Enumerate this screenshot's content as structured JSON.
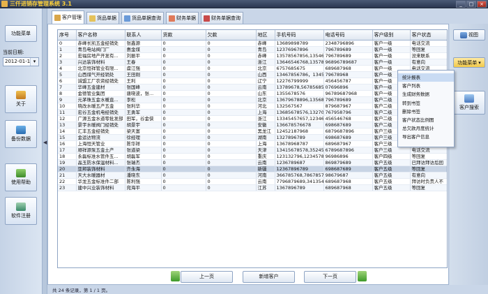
{
  "window": {
    "title": "三仟进销存管理系统 3.1",
    "buttons": [
      "_",
      "□",
      "×"
    ]
  },
  "left_panel": {
    "func_menu": "功能菜单",
    "date_label": "当前日期:",
    "date_value": "2012-01-12",
    "about": "关于",
    "backup": "备份数据",
    "help": "使用帮助",
    "register": "软件注册"
  },
  "tabs": [
    {
      "label": "客户管理",
      "color": "#d9a64a"
    },
    {
      "label": "货品单据",
      "color": "#e5c25a"
    },
    {
      "label": "货品单据查询",
      "color": "#6a9ad8"
    },
    {
      "label": "财务单据",
      "color": "#e07a5a"
    },
    {
      "label": "财务单据查询",
      "color": "#c84a4a"
    }
  ],
  "table": {
    "columns": [
      "序号",
      "客户名称",
      "联系人",
      "货款",
      "欠款",
      "地区",
      "手机号码",
      "电话号码",
      "客户级别",
      "客户状态"
    ],
    "rows": [
      [
        "0",
        "赤峰长凯五金经销处",
        "张鑫源",
        "0",
        "0",
        "赤峰",
        "13689898789",
        "2348796896",
        "客户一级",
        "电话交流"
      ],
      [
        "1",
        "青岛电站阀门厂",
        "惠金煤",
        "0",
        "0",
        "青岛",
        "12376967896",
        "796789689",
        "客户一级",
        "等回复"
      ],
      [
        "2",
        "宏福房地产开发有...",
        "刘振平",
        "0",
        "0",
        "赤峰",
        "13578567856,13546456",
        "796789689",
        "客户一级",
        "没来联系"
      ],
      [
        "3",
        "兴达装饰材料",
        "王春",
        "0",
        "0",
        "浙江",
        "13646546768,135789...",
        "96896789687",
        "客户一级",
        "有意向"
      ],
      [
        "4",
        "北京恒祥管业有限...",
        "虞江强",
        "0",
        "0",
        "北京",
        "6757685675",
        "689687968",
        "客户一级",
        "电话交流"
      ],
      [
        "5",
        "山西煤气开经销处",
        "王田刚",
        "0",
        "0",
        "山西",
        "13467856786，1345...",
        "79678968",
        "客户一级",
        "电话交流"
      ],
      [
        "6",
        "诚盟工厂农资经销处",
        "王利",
        "0",
        "0",
        "辽宁",
        "12276799999",
        "456456787",
        "客户一级",
        "电话交流"
      ],
      [
        "7",
        "华峰五金建材",
        "张国峰",
        "0",
        "0",
        "云南",
        "13789678,56785685",
        "07696896",
        "客户一级",
        "有意向"
      ],
      [
        "8",
        "金德管业集团",
        "唐晓波，张...",
        "0",
        "0",
        "山东",
        "1355678576",
        "96789687968",
        "客户一级",
        "有意向"
      ],
      [
        "9",
        "元茅珠五金水暖直...",
        "李松",
        "0",
        "0",
        "北京",
        "13679678896,13568...",
        "796789689",
        "客户二级",
        "等回复"
      ],
      [
        "10",
        "晓改水暖五产五金",
        "张利华",
        "0",
        "0",
        "河北",
        "132567567",
        "879687967",
        "客户二级",
        "等回复"
      ],
      [
        "11",
        "宏谷五金机电经销处",
        "王勇军",
        "0",
        "0",
        "上海",
        "13685678576,132708...",
        "767958796",
        "客户二级",
        "有意向"
      ],
      [
        "12",
        "广源五金水道零批发部",
        "田军，谷金侠",
        "0",
        "0",
        "浙江",
        "13345457657,123464...",
        "456546768",
        "客户二级",
        "有意向"
      ],
      [
        "13",
        "景宇水暖阀门经销处",
        "胡景宇",
        "0",
        "0",
        "安徽",
        "136678576678",
        "698687689",
        "客户二级",
        "有意向"
      ],
      [
        "14",
        "汇丰五金经销处",
        "梁天富",
        "0",
        "0",
        "黑龙江",
        "12452187968",
        "6879687896",
        "客户三级",
        "没来联系"
      ],
      [
        "15",
        "金运达物流",
        "徐经理",
        "0",
        "0",
        "湖南",
        "1327896789",
        "698687689",
        "客户三级",
        "电话交流"
      ],
      [
        "16",
        "上海恒天管业",
        "陈华祥",
        "0",
        "0",
        "上海",
        "13678968787",
        "689687967",
        "客户三级",
        "电话交流"
      ],
      [
        "17",
        "顺祥源泵五金土产",
        "张道梁",
        "0",
        "0",
        "天津",
        "13415678578,352452...",
        "6789687896",
        "客户三级",
        "电话交流"
      ],
      [
        "18",
        "永磊标准水管件五...",
        "胡磊军",
        "0",
        "0",
        "重庆",
        "123132796,1234578...",
        "96986896",
        "客户四级",
        "等回复"
      ],
      [
        "19",
        "晶玉防水保温材料...",
        "张瑞杰",
        "0",
        "0",
        "云南",
        "1236789687",
        "869879689",
        "客户五级",
        "已拜访拜访后回"
      ],
      [
        "20",
        "亚邦装饰材料",
        "齐永海",
        "0",
        "0",
        "新疆",
        "12367896789",
        "698687689",
        "客户五级",
        "等回复"
      ],
      [
        "21",
        "天大水暖器材",
        "潘晓东",
        "0",
        "0",
        "河南",
        "366785768,78678577987",
        "98679687",
        "客户五级",
        "有意向"
      ],
      [
        "22",
        "华龙五金标准件二部",
        "陈利强",
        "0",
        "0",
        "云南",
        "7796879689,341354243",
        "689687968",
        "客户五级",
        "拜访时负责人不"
      ],
      [
        "23",
        "建中兴业装饰材料",
        "宛海平",
        "0",
        "0",
        "江苏",
        "1367896789",
        "689687968",
        "客户五级",
        "等回复"
      ]
    ]
  },
  "nav": {
    "prev": "上一页",
    "add": "新增客户",
    "next": "下一页"
  },
  "status": "共 24 条记录，第 1 / 1 页。",
  "right_panel": {
    "view": "视图",
    "func_menu": "功能菜单",
    "search": "客户搜索"
  },
  "context_menu": [
    "统计报表",
    "客户列表",
    "生成财务数据",
    "转到书签",
    "删除书签",
    "客户状态比例图",
    "总欠款月度统计",
    "导出客户信息"
  ]
}
